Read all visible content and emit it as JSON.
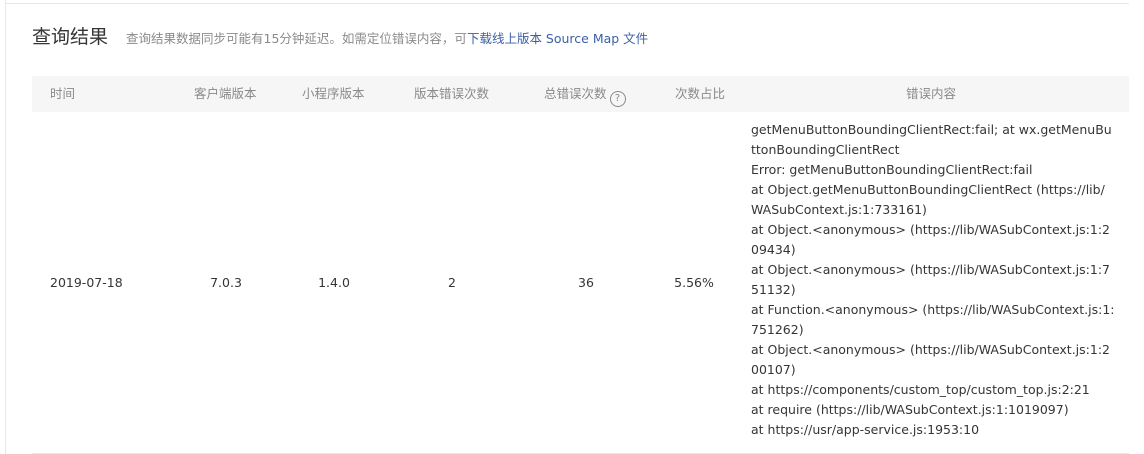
{
  "header": {
    "title": "查询结果",
    "note": "查询结果数据同步可能有15分钟延迟。如需定位错误内容，可",
    "link": "下载线上版本 Source Map 文件"
  },
  "table": {
    "columns": {
      "time": "时间",
      "client_version": "客户端版本",
      "miniprogram_version": "小程序版本",
      "version_errors": "版本错误次数",
      "total_errors": "总错误次数",
      "ratio": "次数占比",
      "error_content": "错误内容"
    },
    "help_icon": "help-icon",
    "rows": [
      {
        "time": "2019-07-18",
        "client_version": "7.0.3",
        "miniprogram_version": "1.4.0",
        "version_errors": "2",
        "total_errors": "36",
        "ratio": "5.56%",
        "error_lines": [
          "getMenuButtonBoundingClientRect:fail; at wx.getMenuButtonBoundingClientRect",
          "Error: getMenuButtonBoundingClientRect:fail",
          "at Object.getMenuButtonBoundingClientRect (https://lib/WASubContext.js:1:733161)",
          "at Object.<anonymous> (https://lib/WASubContext.js:1:209434)",
          "at Object.<anonymous> (https://lib/WASubContext.js:1:751132)",
          "at Function.<anonymous> (https://lib/WASubContext.js:1:751262)",
          "at Object.<anonymous> (https://lib/WASubContext.js:1:200107)",
          "at https://components/custom_top/custom_top.js:2:21",
          "at require (https://lib/WASubContext.js:1:1019097)",
          "at https://usr/app-service.js:1953:10"
        ]
      }
    ]
  }
}
